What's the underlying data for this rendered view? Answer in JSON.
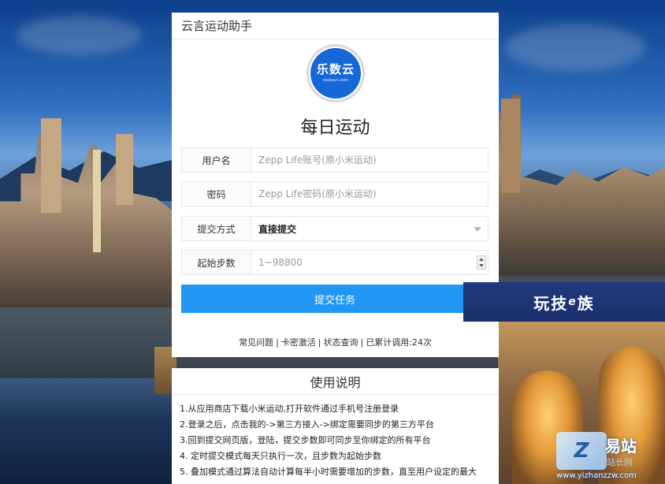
{
  "header": {
    "title": "云言运动助手"
  },
  "logo": {
    "text": "乐数云",
    "subtext": "lesbyun.com"
  },
  "page": {
    "title": "每日运动"
  },
  "form": {
    "username": {
      "label": "用户名",
      "placeholder": "Zepp Life账号(原小米运动)",
      "value": ""
    },
    "password": {
      "label": "密码",
      "placeholder": "Zepp Life密码(原小米运动)",
      "value": ""
    },
    "submit_mode": {
      "label": "提交方式",
      "selected": "直接提交"
    },
    "start_steps": {
      "label": "起始步数",
      "placeholder": "1~98800",
      "value": ""
    },
    "submit_label": "提交任务"
  },
  "links": {
    "faq": "常见问题",
    "card_activate": "卡密激活",
    "status_query": "状态查询",
    "total_calls": "已累计调用:24次"
  },
  "usage": {
    "title": "使用说明",
    "items": [
      "1.从应用商店下载小米运动,打开软件通过手机号注册登录",
      "2.登录之后，点击我的->第三方接入->绑定需要同步的第三方平台",
      "3.回到提交网页版，登陆，提交步数即可同步至你绑定的所有平台",
      "4. 定时提交模式每天只执行一次，且步数为起始步数",
      "5. 叠加模式通过算法自动计算每半小时需要增加的步数，直至用户设定的最大"
    ]
  },
  "watermark": {
    "banner_main": "玩技",
    "banner_e": "e",
    "banner_tail": "族",
    "site_logo": "Z",
    "site_name": "易站",
    "site_slogan": "站长网",
    "site_url": "www.yizhanzzw.com"
  },
  "colors": {
    "primary_button": "#2196f3",
    "logo_blue": "#1867d8"
  }
}
